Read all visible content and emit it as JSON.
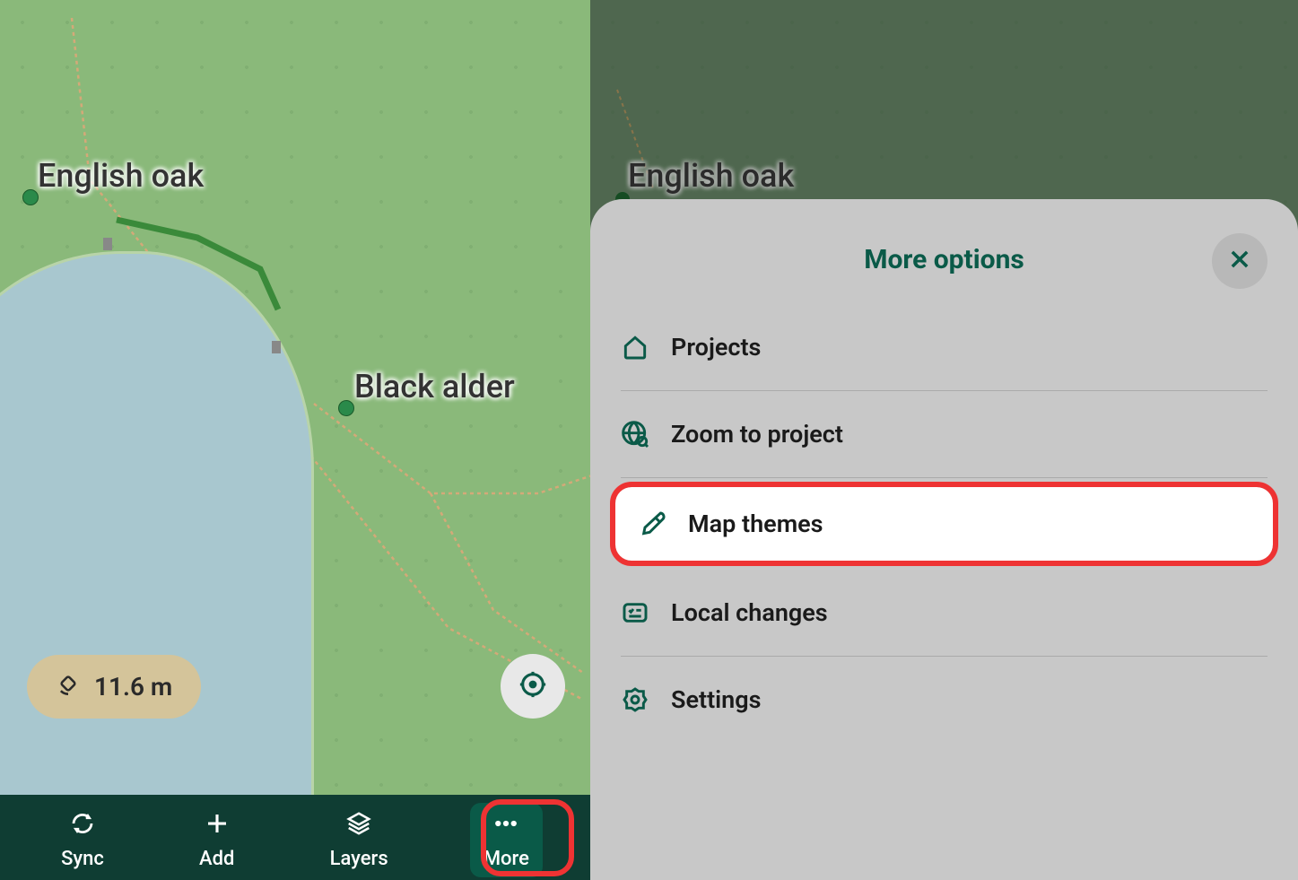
{
  "map": {
    "labels": {
      "english_oak": "English oak",
      "black_alder": "Black alder"
    },
    "distance": "11.6 m"
  },
  "nav": {
    "sync": "Sync",
    "add": "Add",
    "layers": "Layers",
    "more": "More"
  },
  "panel": {
    "title": "More options",
    "items": {
      "projects": "Projects",
      "zoom": "Zoom to project",
      "themes": "Map themes",
      "local": "Local changes",
      "settings": "Settings"
    }
  }
}
